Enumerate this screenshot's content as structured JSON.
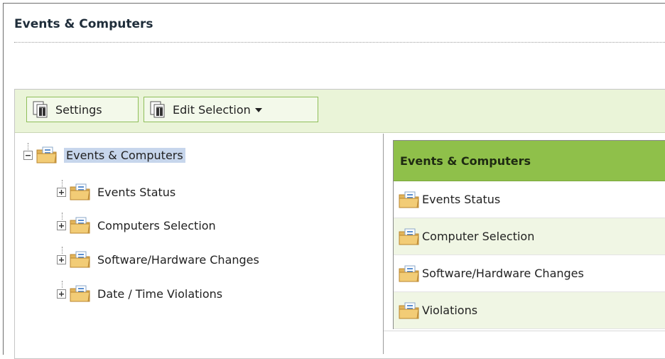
{
  "page": {
    "title": "Events & Computers"
  },
  "toolbar": {
    "settings_label": "Settings",
    "edit_selection_label": "Edit Selection"
  },
  "tree": {
    "root": {
      "label": "Events & Computers",
      "expanded": true,
      "selected": true
    },
    "children": [
      {
        "label": "Events Status",
        "expanded": false
      },
      {
        "label": "Computers Selection",
        "expanded": false
      },
      {
        "label": "Software/Hardware Changes",
        "expanded": false
      },
      {
        "label": "Date / Time Violations",
        "expanded": false
      }
    ]
  },
  "content": {
    "header": "Events & Computers",
    "rows": [
      {
        "label": "Events Status"
      },
      {
        "label": "Computer Selection"
      },
      {
        "label": "Software/Hardware Changes"
      },
      {
        "label": "Violations"
      }
    ]
  },
  "colors": {
    "toolbar_bg": "#eaf4d8",
    "header_green": "#8fc04a",
    "row_alt": "#f0f6e4",
    "selection": "#c7d6ec"
  }
}
